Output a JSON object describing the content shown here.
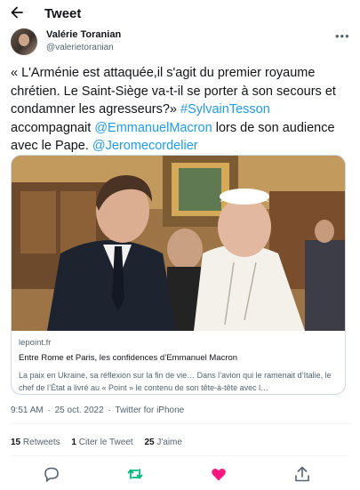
{
  "header": {
    "title": "Tweet"
  },
  "author": {
    "name": "Valérie Toranian",
    "handle": "@valerietoranian"
  },
  "tweet": {
    "text_plain": "« L'Arménie est attaquée,il s'agit du premier royaume chrétien. Le Saint-Siège va-t-il se porter à son secours et condamner les agresseurs?» ",
    "hashtag": "#SylvainTesson",
    "text_2": " accompagnait ",
    "mention_1": "@EmmanuelMacron",
    "text_3": " lors de son audience avec le Pape. ",
    "mention_2": "@Jeromecordelier"
  },
  "card": {
    "domain": "lepoint.fr",
    "title": "Entre Rome et Paris, les confidences d’Emmanuel Macron",
    "description": "La paix en Ukraine, sa réflexion sur la fin de vie… Dans l’avion qui le ramenait d’Italie, le chef de l’État a livré au « Point » le contenu de son tête-à-tête avec l…"
  },
  "meta": {
    "time": "9:51 AM",
    "dot": "·",
    "date": "25 oct. 2022",
    "source": "Twitter for iPhone"
  },
  "stats": {
    "retweets_count": "15",
    "retweets_label": "Retweets",
    "quotes_count": "1",
    "quotes_label": "Citer le Tweet",
    "likes_count": "25",
    "likes_label": "J'aime"
  },
  "colors": {
    "link": "#1d9bf0",
    "retweet_active": "#00ba7c",
    "like_active": "#f91880",
    "secondary_text": "#536471"
  },
  "icons": {
    "back": "arrow-left-icon",
    "more": "more-horizontal-icon",
    "reply": "comment-icon",
    "retweet": "retweet-icon",
    "like": "heart-icon",
    "share": "share-icon"
  }
}
